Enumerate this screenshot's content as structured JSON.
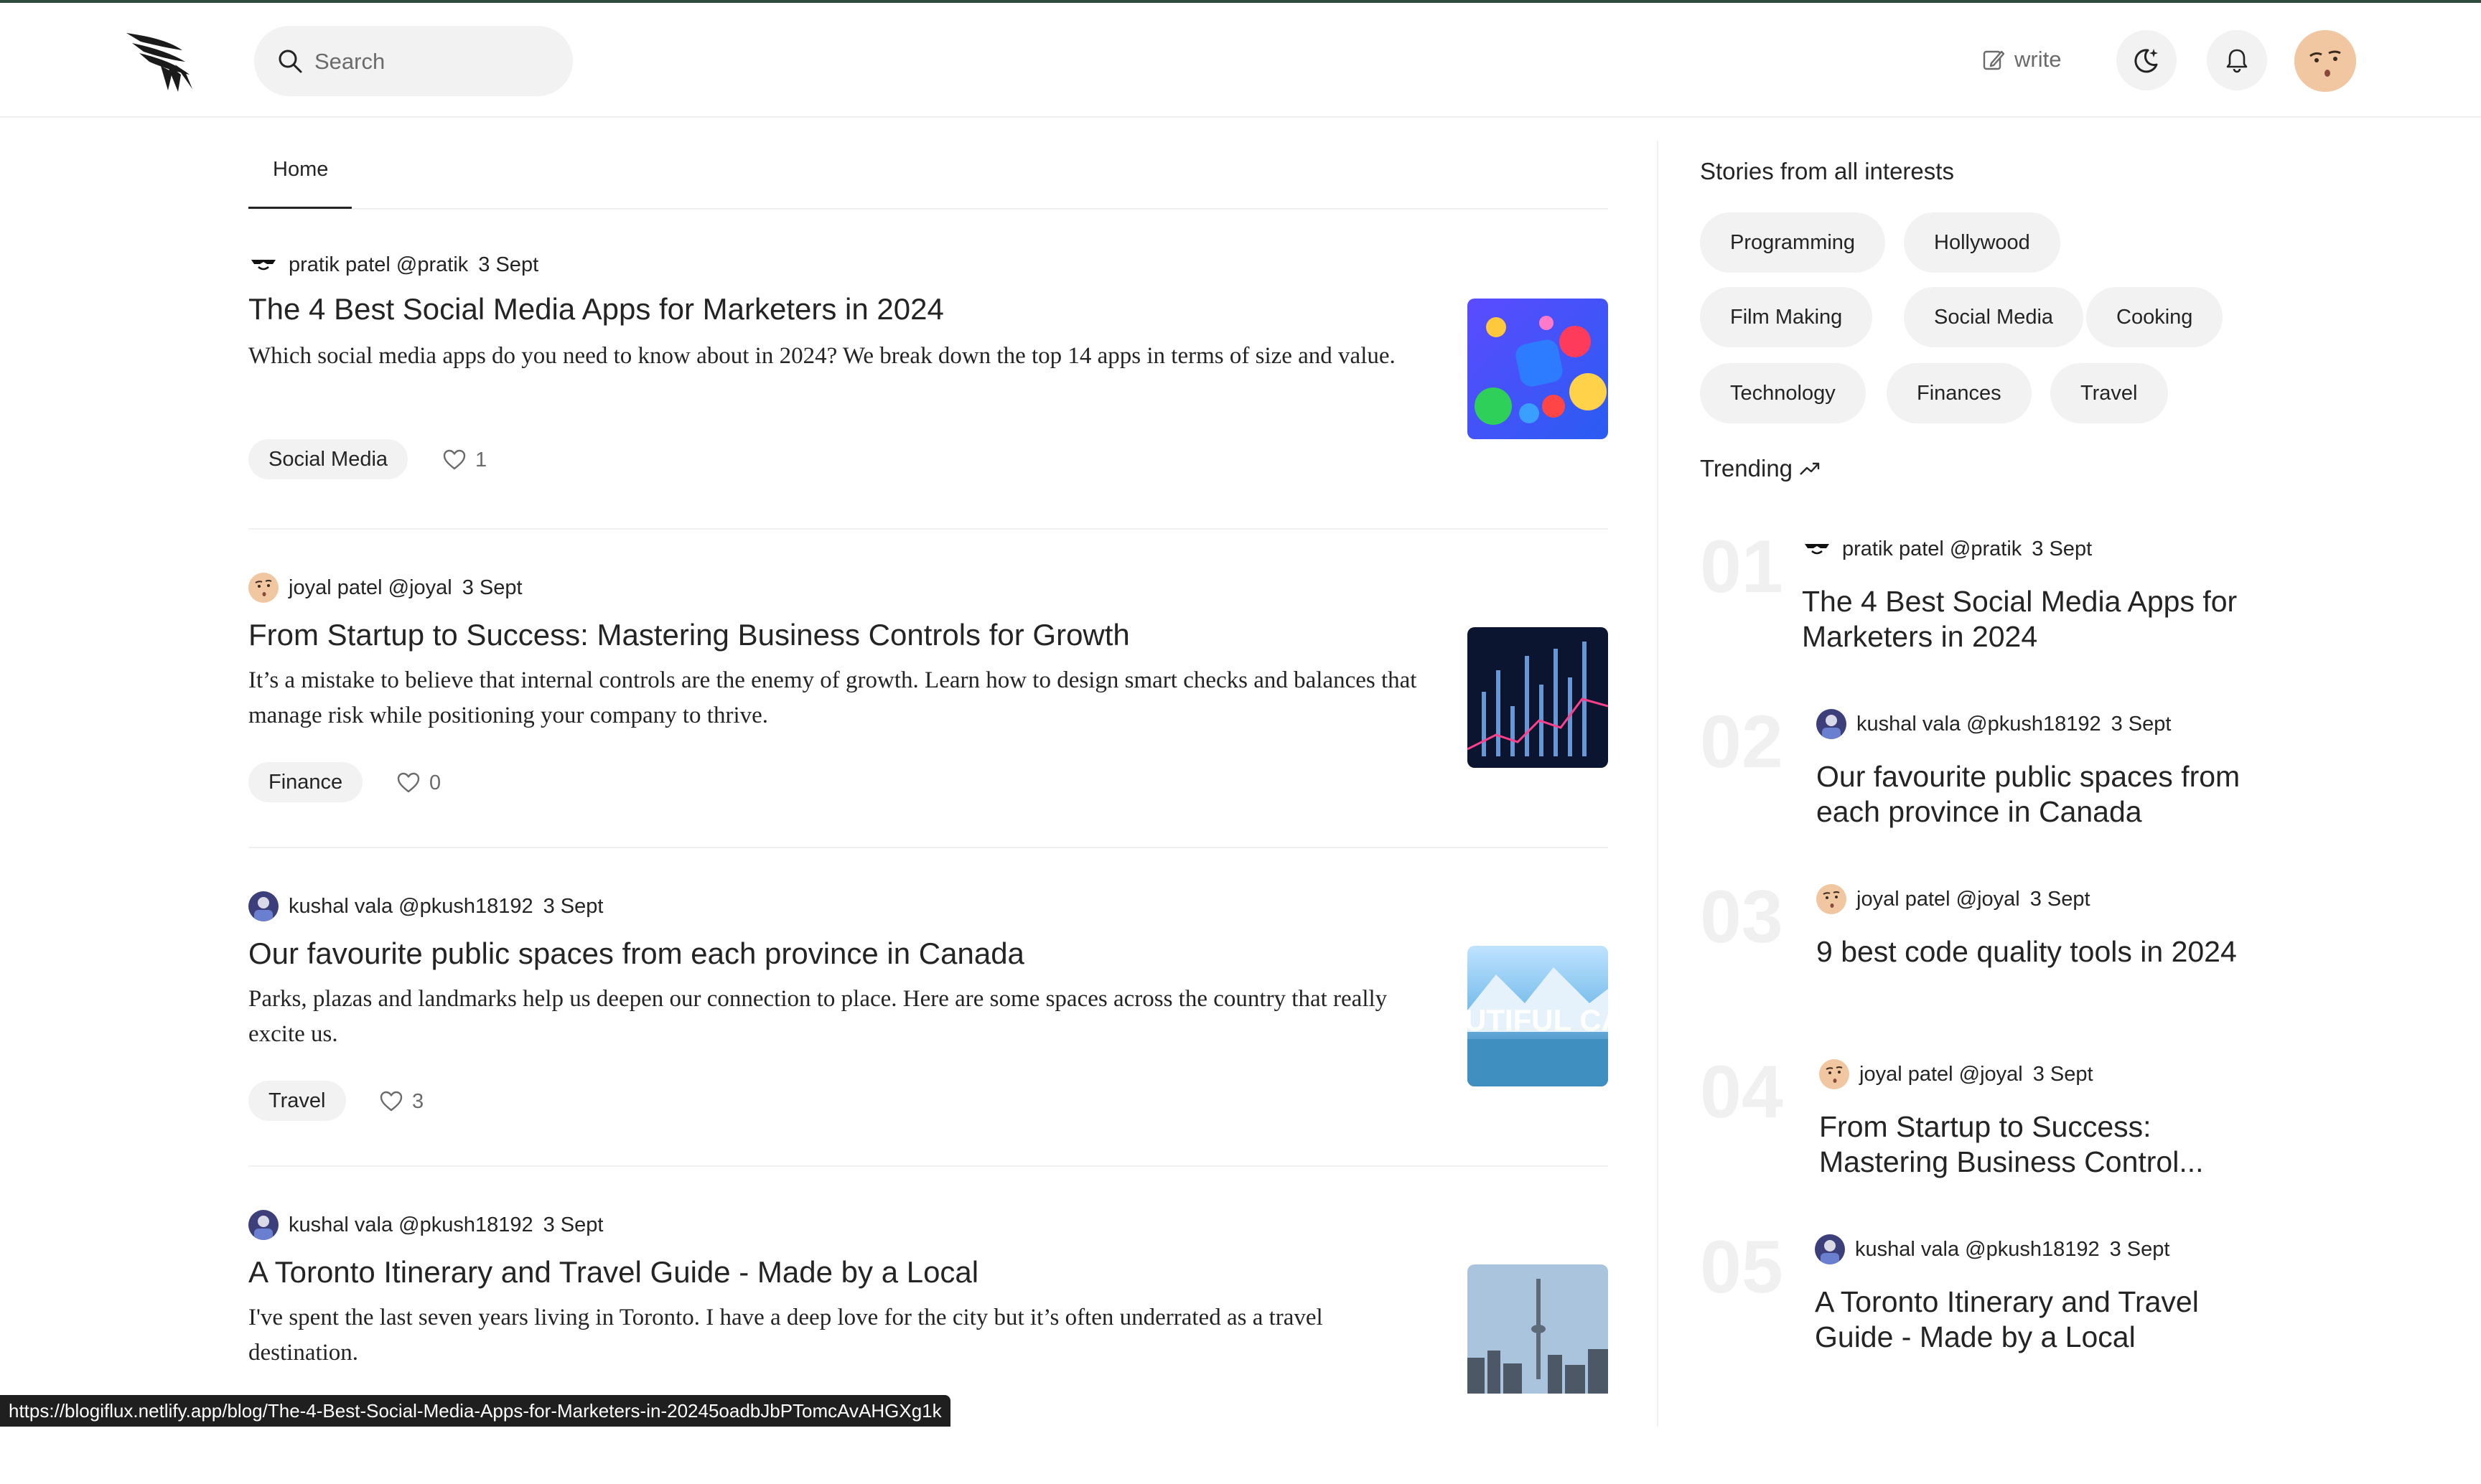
{
  "header": {
    "search_placeholder": "Search",
    "write_label": "write",
    "icons": [
      "logo-wing",
      "search-icon",
      "edit-icon",
      "moon-theme-icon",
      "bell-icon",
      "avatar"
    ]
  },
  "tabs": [
    {
      "label": "Home",
      "active": true
    }
  ],
  "articles": [
    {
      "author": "pratik patel @pratik",
      "date": "3 Sept",
      "title": "The 4 Best Social Media Apps for Marketers in 2024",
      "description": "Which social media apps do you need to know about in 2024? We break down the top 14 apps in terms of size and value.",
      "tag": "Social Media",
      "likes": "1"
    },
    {
      "author": "joyal patel @joyal",
      "date": "3 Sept",
      "title": "From Startup to Success: Mastering Business Controls for Growth",
      "description": "It’s a mistake to believe that internal controls are the enemy of growth. Learn how to design smart checks and balances that manage risk while positioning your company to thrive.",
      "tag": "Finance",
      "likes": "0"
    },
    {
      "author": "kushal vala @pkush18192",
      "date": "3 Sept",
      "title": "Our favourite public spaces from each province in Canada",
      "description": "Parks, plazas and landmarks help us deepen our connection to place. Here are some spaces across the country that really excite us.",
      "tag": "Travel",
      "likes": "3",
      "thumb_text": "UTIFUL CAN"
    },
    {
      "author": "kushal vala @pkush18192",
      "date": "3 Sept",
      "title": "A Toronto Itinerary and Travel Guide - Made by a Local",
      "description": "I've spent the last seven years living in Toronto. I have a deep love for the city but it’s often underrated as a travel destination."
    }
  ],
  "sidebar": {
    "interests_heading": "Stories from all interests",
    "topics": [
      "Programming",
      "Hollywood",
      "Film Making",
      "Social Media",
      "Cooking",
      "Technology",
      "Finances",
      "Travel"
    ],
    "trending_heading": "Trending",
    "trending": [
      {
        "num": "01",
        "author": "pratik patel @pratik",
        "date": "3 Sept",
        "title": "The 4 Best Social Media Apps for Marketers in 2024"
      },
      {
        "num": "02",
        "author": "kushal vala @pkush18192",
        "date": "3 Sept",
        "title": "Our favourite public spaces from each province in Canada"
      },
      {
        "num": "03",
        "author": "joyal patel @joyal",
        "date": "3 Sept",
        "title": "9 best code quality tools in 2024"
      },
      {
        "num": "04",
        "author": "joyal patel @joyal",
        "date": "3 Sept",
        "title": "From Startup to Success: Mastering Business Control..."
      },
      {
        "num": "05",
        "author": "kushal vala @pkush18192",
        "date": "3 Sept",
        "title": "A Toronto Itinerary and Travel Guide - Made by a Local"
      }
    ]
  },
  "status_url": "https://blogiflux.netlify.app/blog/The-4-Best-Social-Media-Apps-for-Marketers-in-20245oadbJbPTomcAvAHGXg1k"
}
